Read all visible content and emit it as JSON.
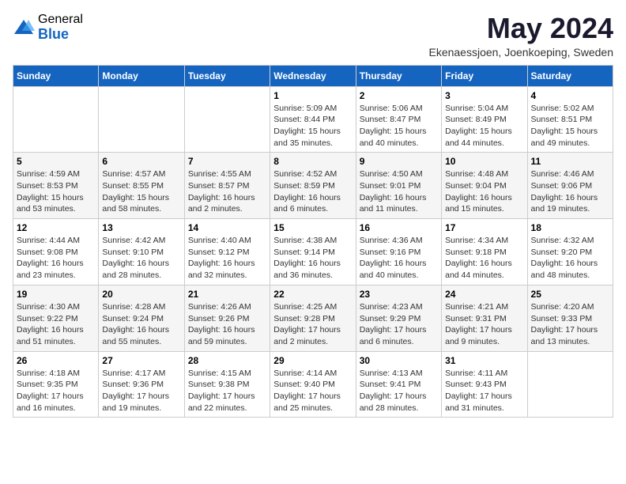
{
  "logo": {
    "general": "General",
    "blue": "Blue"
  },
  "title": "May 2024",
  "location": "Ekenaessjoen, Joenkoeping, Sweden",
  "weekdays": [
    "Sunday",
    "Monday",
    "Tuesday",
    "Wednesday",
    "Thursday",
    "Friday",
    "Saturday"
  ],
  "weeks": [
    [
      {
        "day": "",
        "info": ""
      },
      {
        "day": "",
        "info": ""
      },
      {
        "day": "",
        "info": ""
      },
      {
        "day": "1",
        "info": "Sunrise: 5:09 AM\nSunset: 8:44 PM\nDaylight: 15 hours\nand 35 minutes."
      },
      {
        "day": "2",
        "info": "Sunrise: 5:06 AM\nSunset: 8:47 PM\nDaylight: 15 hours\nand 40 minutes."
      },
      {
        "day": "3",
        "info": "Sunrise: 5:04 AM\nSunset: 8:49 PM\nDaylight: 15 hours\nand 44 minutes."
      },
      {
        "day": "4",
        "info": "Sunrise: 5:02 AM\nSunset: 8:51 PM\nDaylight: 15 hours\nand 49 minutes."
      }
    ],
    [
      {
        "day": "5",
        "info": "Sunrise: 4:59 AM\nSunset: 8:53 PM\nDaylight: 15 hours\nand 53 minutes."
      },
      {
        "day": "6",
        "info": "Sunrise: 4:57 AM\nSunset: 8:55 PM\nDaylight: 15 hours\nand 58 minutes."
      },
      {
        "day": "7",
        "info": "Sunrise: 4:55 AM\nSunset: 8:57 PM\nDaylight: 16 hours\nand 2 minutes."
      },
      {
        "day": "8",
        "info": "Sunrise: 4:52 AM\nSunset: 8:59 PM\nDaylight: 16 hours\nand 6 minutes."
      },
      {
        "day": "9",
        "info": "Sunrise: 4:50 AM\nSunset: 9:01 PM\nDaylight: 16 hours\nand 11 minutes."
      },
      {
        "day": "10",
        "info": "Sunrise: 4:48 AM\nSunset: 9:04 PM\nDaylight: 16 hours\nand 15 minutes."
      },
      {
        "day": "11",
        "info": "Sunrise: 4:46 AM\nSunset: 9:06 PM\nDaylight: 16 hours\nand 19 minutes."
      }
    ],
    [
      {
        "day": "12",
        "info": "Sunrise: 4:44 AM\nSunset: 9:08 PM\nDaylight: 16 hours\nand 23 minutes."
      },
      {
        "day": "13",
        "info": "Sunrise: 4:42 AM\nSunset: 9:10 PM\nDaylight: 16 hours\nand 28 minutes."
      },
      {
        "day": "14",
        "info": "Sunrise: 4:40 AM\nSunset: 9:12 PM\nDaylight: 16 hours\nand 32 minutes."
      },
      {
        "day": "15",
        "info": "Sunrise: 4:38 AM\nSunset: 9:14 PM\nDaylight: 16 hours\nand 36 minutes."
      },
      {
        "day": "16",
        "info": "Sunrise: 4:36 AM\nSunset: 9:16 PM\nDaylight: 16 hours\nand 40 minutes."
      },
      {
        "day": "17",
        "info": "Sunrise: 4:34 AM\nSunset: 9:18 PM\nDaylight: 16 hours\nand 44 minutes."
      },
      {
        "day": "18",
        "info": "Sunrise: 4:32 AM\nSunset: 9:20 PM\nDaylight: 16 hours\nand 48 minutes."
      }
    ],
    [
      {
        "day": "19",
        "info": "Sunrise: 4:30 AM\nSunset: 9:22 PM\nDaylight: 16 hours\nand 51 minutes."
      },
      {
        "day": "20",
        "info": "Sunrise: 4:28 AM\nSunset: 9:24 PM\nDaylight: 16 hours\nand 55 minutes."
      },
      {
        "day": "21",
        "info": "Sunrise: 4:26 AM\nSunset: 9:26 PM\nDaylight: 16 hours\nand 59 minutes."
      },
      {
        "day": "22",
        "info": "Sunrise: 4:25 AM\nSunset: 9:28 PM\nDaylight: 17 hours\nand 2 minutes."
      },
      {
        "day": "23",
        "info": "Sunrise: 4:23 AM\nSunset: 9:29 PM\nDaylight: 17 hours\nand 6 minutes."
      },
      {
        "day": "24",
        "info": "Sunrise: 4:21 AM\nSunset: 9:31 PM\nDaylight: 17 hours\nand 9 minutes."
      },
      {
        "day": "25",
        "info": "Sunrise: 4:20 AM\nSunset: 9:33 PM\nDaylight: 17 hours\nand 13 minutes."
      }
    ],
    [
      {
        "day": "26",
        "info": "Sunrise: 4:18 AM\nSunset: 9:35 PM\nDaylight: 17 hours\nand 16 minutes."
      },
      {
        "day": "27",
        "info": "Sunrise: 4:17 AM\nSunset: 9:36 PM\nDaylight: 17 hours\nand 19 minutes."
      },
      {
        "day": "28",
        "info": "Sunrise: 4:15 AM\nSunset: 9:38 PM\nDaylight: 17 hours\nand 22 minutes."
      },
      {
        "day": "29",
        "info": "Sunrise: 4:14 AM\nSunset: 9:40 PM\nDaylight: 17 hours\nand 25 minutes."
      },
      {
        "day": "30",
        "info": "Sunrise: 4:13 AM\nSunset: 9:41 PM\nDaylight: 17 hours\nand 28 minutes."
      },
      {
        "day": "31",
        "info": "Sunrise: 4:11 AM\nSunset: 9:43 PM\nDaylight: 17 hours\nand 31 minutes."
      },
      {
        "day": "",
        "info": ""
      }
    ]
  ]
}
